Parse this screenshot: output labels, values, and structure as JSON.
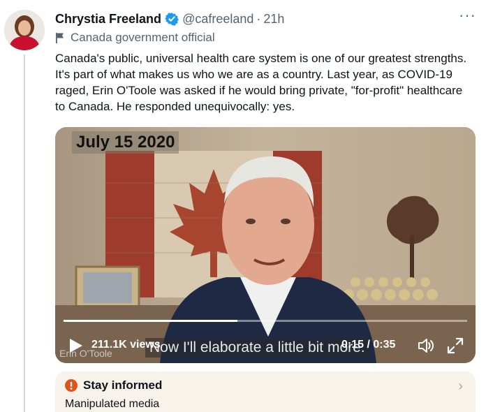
{
  "author": {
    "name": "Chrystia Freeland",
    "handle": "@cafreeland",
    "separator": "·",
    "time": "21h",
    "label": "Canada government official"
  },
  "tweet": {
    "text": "Canada's public, universal health care system is one of our greatest strengths. It's part of what makes us who we are as a country. Last year, as COVID-19 raged, Erin O'Toole was asked if he would bring private, \"for-profit\" healthcare to Canada. He responded unequivocally: yes."
  },
  "video": {
    "date_tag": "July 15 2020",
    "caption": "Now I'll elaborate a little bit more.",
    "lower_third": "Erin O'Toole",
    "views": "211.1K views",
    "timecode": "0:15 / 0:35",
    "progress": 0.43
  },
  "notice": {
    "title": "Stay informed",
    "subtitle": "Manipulated media",
    "chevron": "›"
  },
  "colors": {
    "verified": "#1d9bf0",
    "alert": "#e0531b",
    "secondary_text": "#536471"
  },
  "icons": [
    "verified-badge-icon",
    "more-icon",
    "flag-icon",
    "play-icon",
    "volume-icon",
    "fullscreen-icon",
    "alert-icon",
    "chevron-right-icon"
  ]
}
